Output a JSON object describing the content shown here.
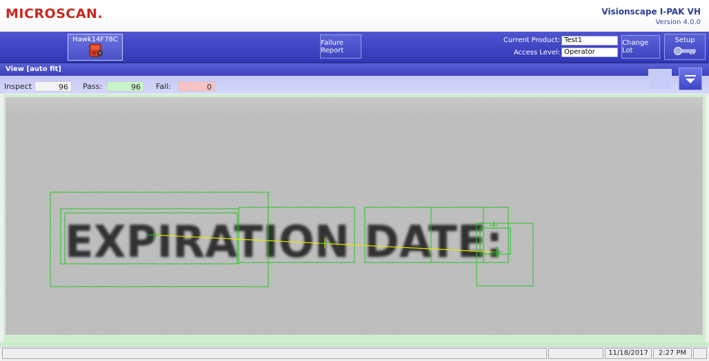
{
  "header": {
    "logo": "MICROSCAN",
    "logo_dot": ".",
    "product_name": "Visionscape I-PAK VH",
    "version": "Version 4.0.0"
  },
  "toolbar": {
    "camera_label": "Hawk14F78C",
    "failure_report": "Failure Report",
    "current_product_label": "Current Product:",
    "current_product_value": "Test1",
    "access_level_label": "Access Level:",
    "access_level_value": "Operator",
    "change_lot": "Change Lot",
    "setup": "Setup"
  },
  "view": {
    "title": "View [auto fit]",
    "inspect_label": "Inspect",
    "inspect_value": "96",
    "pass_label": "Pass:",
    "pass_value": "96",
    "fail_label": "Fail:",
    "fail_value": "0"
  },
  "image": {
    "text": "EXPIRATION DATE:"
  },
  "statusbar": {
    "date": "11/18/2017",
    "time": "2:27 PM"
  },
  "colors": {
    "toolbar_blue": "#3c42c0",
    "brand_red": "#c8281e",
    "pass_green": "#c8f5c8",
    "fail_red": "#f7c3c3",
    "roi_green": "#22c322",
    "line_yellow": "#e8e800"
  }
}
